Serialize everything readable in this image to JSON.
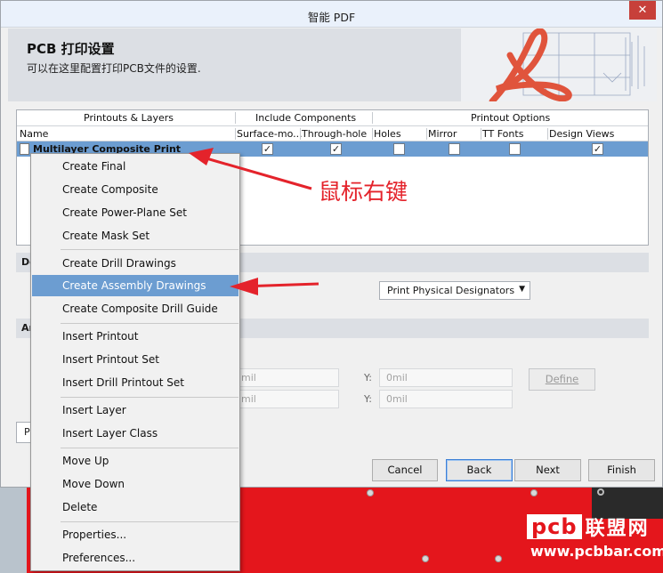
{
  "window": {
    "title": "智能 PDF",
    "close_glyph": "✕"
  },
  "header": {
    "title": "PCB 打印设置",
    "subtitle": "可以在这里配置打印PCB文件的设置."
  },
  "grid": {
    "group_headers": [
      "Printouts & Layers",
      "Include Components",
      "Printout Options"
    ],
    "columns": [
      "Name",
      "Surface-mo...",
      "Through-hole",
      "Holes",
      "Mirror",
      "TT Fonts",
      "Design Views"
    ],
    "row": {
      "name": "Multilayer Composite Print",
      "checked": {
        "surface_mount": true,
        "through_hole": true,
        "holes": false,
        "mirror": false,
        "tt_fonts": false,
        "design_views": true
      }
    },
    "check_glyph": "✓"
  },
  "sections": {
    "first_stub": "De",
    "second_stub": "Ar"
  },
  "designators": {
    "selected": "Print Physical Designators"
  },
  "fields": {
    "y_label": "Y:",
    "y1_value": "0mil",
    "y2_value": "0mil",
    "x1_value": "mil",
    "x2_value": "mil",
    "define_label": "Define"
  },
  "left_stub": "P",
  "footer": {
    "cancel": "Cancel",
    "back": "Back",
    "next": "Next",
    "finish": "Finish"
  },
  "context_menu": {
    "items": [
      "Create Final",
      "Create Composite",
      "Create Power-Plane Set",
      "Create Mask Set",
      "Create Drill Drawings",
      "Create Assembly Drawings",
      "Create Composite Drill Guide",
      "Insert Printout",
      "Insert Printout Set",
      "Insert Drill Printout Set",
      "Insert Layer",
      "Insert Layer Class",
      "Move Up",
      "Move Down",
      "Delete",
      "Properties...",
      "Preferences..."
    ],
    "highlighted_item": "Create Assembly Drawings"
  },
  "annotation": {
    "text": "鼠标右键",
    "color": "#e4232b"
  },
  "watermark": {
    "logo": "pcb",
    "name": "联盟网",
    "url": "www.pcbbar.com"
  },
  "colors": {
    "selection": "#6c9dd1",
    "pcb_red": "#e4161c",
    "annotation_red": "#e4232b"
  }
}
